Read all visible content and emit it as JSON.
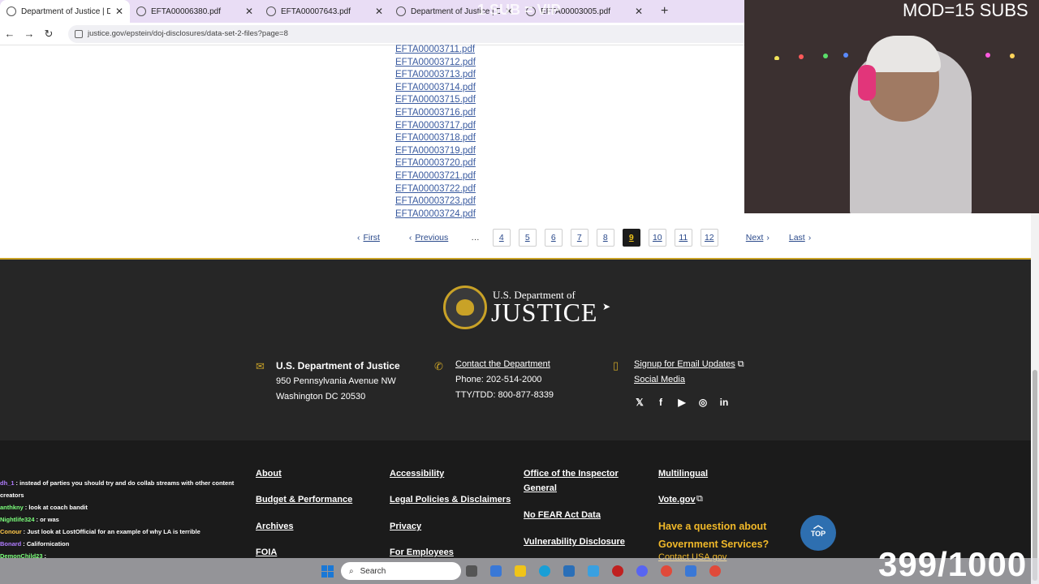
{
  "browser": {
    "tabs": [
      {
        "title": "Department of Justice | Data Se",
        "active": true
      },
      {
        "title": "EFTA00006380.pdf",
        "active": false
      },
      {
        "title": "EFTA00007643.pdf",
        "active": false
      },
      {
        "title": "Department of Justice | Data S",
        "active": false
      },
      {
        "title": "EFTA00003005.pdf",
        "active": false
      }
    ],
    "new_tab": "+",
    "url": "justice.gov/epstein/doj-disclosures/data-set-2-files?page=8"
  },
  "files": [
    "EFTA00003711.pdf",
    "EFTA00003712.pdf",
    "EFTA00003713.pdf",
    "EFTA00003714.pdf",
    "EFTA00003715.pdf",
    "EFTA00003716.pdf",
    "EFTA00003717.pdf",
    "EFTA00003718.pdf",
    "EFTA00003719.pdf",
    "EFTA00003720.pdf",
    "EFTA00003721.pdf",
    "EFTA00003722.pdf",
    "EFTA00003723.pdf",
    "EFTA00003724.pdf"
  ],
  "pager": {
    "first": "First",
    "previous": "Previous",
    "ellipsis": "…",
    "pages": [
      "4",
      "5",
      "6",
      "7",
      "8",
      "9",
      "10",
      "11",
      "12"
    ],
    "current": "9",
    "next": "Next",
    "last": "Last"
  },
  "footer": {
    "logo_top": "U.S. Department of",
    "logo_main": "JUSTICE",
    "address_heading": "U.S. Department of Justice",
    "address_line1": "950 Pennsylvania Avenue NW",
    "address_line2": "Washington DC 20530",
    "contact_link": "Contact the Department",
    "phone": "Phone: 202-514-2000",
    "tty": "TTY/TDD: 800-877-8339",
    "signup_link": "Signup for Email Updates",
    "social_media": "Social Media",
    "social_icons": [
      "x-icon",
      "facebook-icon",
      "youtube-icon",
      "instagram-icon",
      "linkedin-icon"
    ],
    "links": {
      "about": "About",
      "budget": "Budget & Performance",
      "archives": "Archives",
      "foia": "FOIA",
      "accessibility": "Accessibility",
      "legal": "Legal Policies & Disclaimers",
      "privacy": "Privacy",
      "employees": "For Employees",
      "oig": "Office of the Inspector General",
      "nofear": "No FEAR Act Data",
      "vuln": "Vulnerability Disclosure",
      "multilingual": "Multilingual",
      "vote": "Vote.gov"
    },
    "gov_question": "Have a question about Government Services?",
    "contact_usa": "Contact USA.gov",
    "top_button": "TOP"
  },
  "stream": {
    "mod_text": "MOD=15 SUBS",
    "sub_watermark": "1 SUB = VIP",
    "counter": "399/1000",
    "chat": [
      {
        "user": "dh_1",
        "msg": ": instead of parties you should try and do collab streams with other content creators",
        "color": "#b07cff"
      },
      {
        "user": "anthkny",
        "msg": ": look at coach bandit",
        "color": "#7cff7c"
      },
      {
        "user": "Nightlife324",
        "msg": ": or was",
        "color": "#7cff7c"
      },
      {
        "user": "Conour",
        "msg": ": Just look at LostOfficial for an example of why LA is terrible",
        "color": "#ffc84a"
      },
      {
        "user": "Bonard",
        "msg": ": Californication",
        "color": "#b07cff"
      },
      {
        "user": "DemonChild23",
        "msg": ":",
        "color": "#7cff7c"
      }
    ]
  },
  "taskbar": {
    "search": "Search"
  },
  "colors": {
    "link": "#3a5ba0",
    "footer_bg": "#262626",
    "gold": "#c9a227",
    "accent_yellow": "#f0b829",
    "top_button": "#2e6fb0"
  }
}
